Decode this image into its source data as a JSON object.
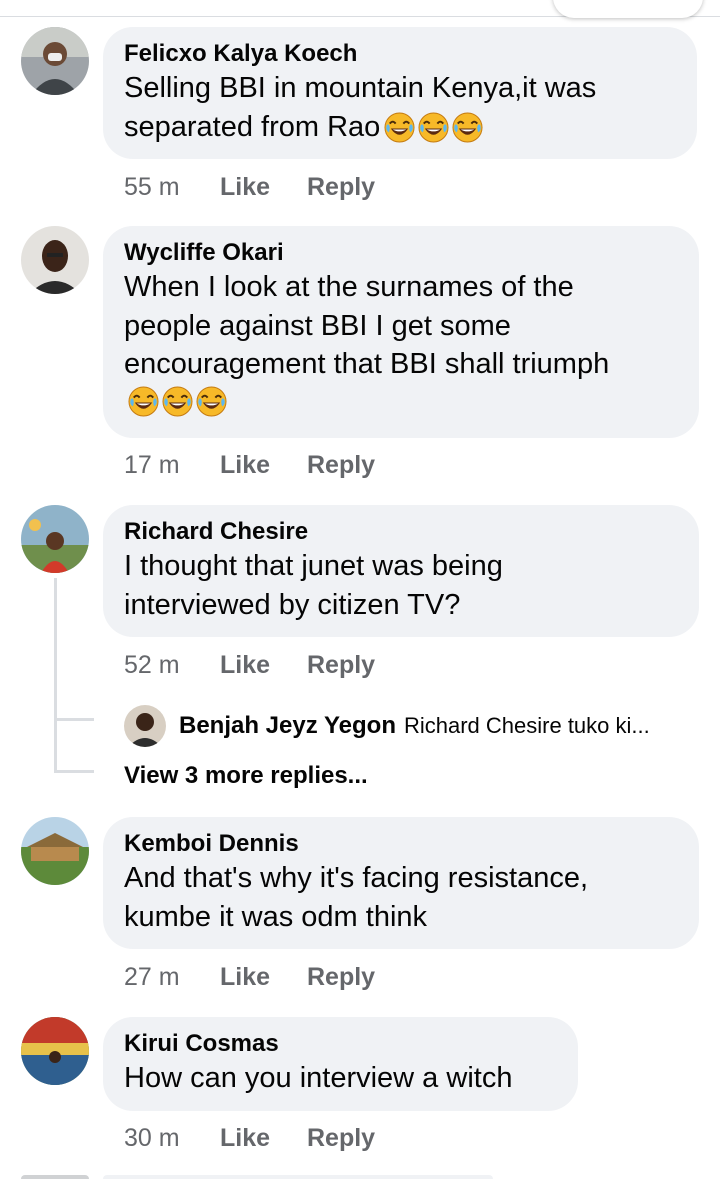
{
  "comments": [
    {
      "author": "Felicxo Kalya Koech",
      "text_lines": [
        "Selling BBI in mountain Kenya,it was",
        "separated from Rao"
      ],
      "emoji_count": 3,
      "time": "55 m",
      "like_label": "Like",
      "reply_label": "Reply"
    },
    {
      "author": "Wycliffe Okari",
      "text_lines": [
        "When I look at the surnames of the",
        "people against BBI I get some",
        "encouragement that BBI shall triumph"
      ],
      "emoji_count": 3,
      "time": "17 m",
      "like_label": "Like",
      "reply_label": "Reply"
    },
    {
      "author": "Richard Chesire",
      "text_lines": [
        "I thought that junet was being",
        "interviewed by citizen TV?"
      ],
      "time": "52 m",
      "like_label": "Like",
      "reply_label": "Reply",
      "reply_preview": {
        "author": "Benjah Jeyz Yegon",
        "text": "Richard Chesire tuko ki..."
      },
      "view_more": "View 3 more replies..."
    },
    {
      "author": "Kemboi Dennis",
      "text_lines": [
        "And that's why it's facing resistance,",
        "kumbe it was odm think"
      ],
      "time": "27 m",
      "like_label": "Like",
      "reply_label": "Reply"
    },
    {
      "author": "Kirui Cosmas",
      "text_lines": [
        "How can you interview a witch"
      ],
      "time": "30 m",
      "like_label": "Like",
      "reply_label": "Reply"
    }
  ],
  "icons": {
    "laugh_emoji": "face-with-tears-of-joy-icon"
  },
  "colors": {
    "bubble": "#f0f2f5",
    "meta_text": "#65676b",
    "thread_line": "#dadde1"
  }
}
